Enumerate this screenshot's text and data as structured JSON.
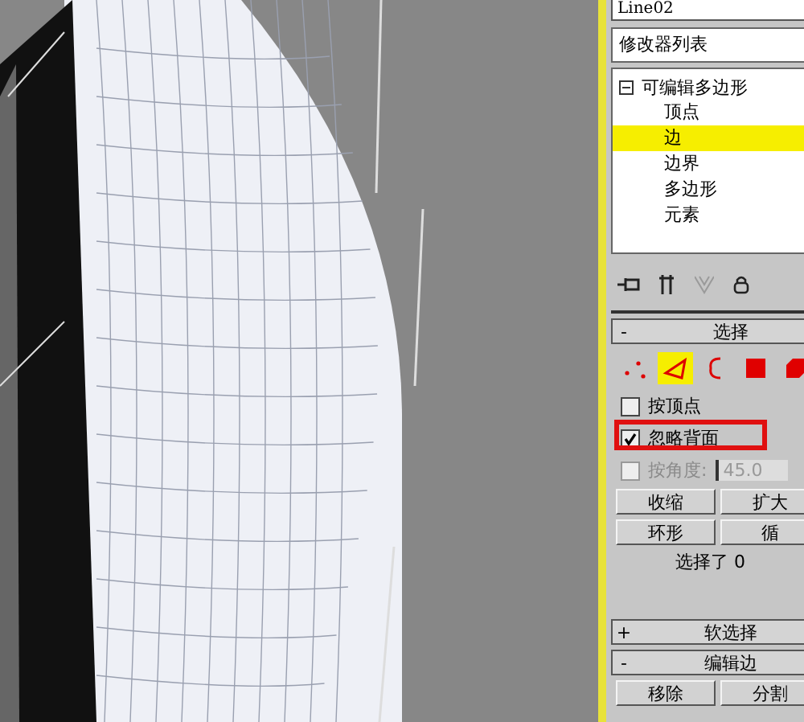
{
  "object_name": "Line02",
  "modifier_list": {
    "value": "修改器列表"
  },
  "stack": {
    "label": "可编辑多边形",
    "expanded": true,
    "children": [
      {
        "label": "顶点",
        "selected": false
      },
      {
        "label": "边",
        "selected": true
      },
      {
        "label": "边界",
        "selected": false
      },
      {
        "label": "多边形",
        "selected": false
      },
      {
        "label": "元素",
        "selected": false
      }
    ]
  },
  "selection": {
    "toggle": "-",
    "title": "选择",
    "levels": [
      {
        "kind": "vertex",
        "selected": false
      },
      {
        "kind": "edge",
        "selected": true
      },
      {
        "kind": "border",
        "selected": false
      },
      {
        "kind": "polygon",
        "selected": false
      },
      {
        "kind": "element",
        "selected": false
      }
    ],
    "options": [
      {
        "label": "按顶点",
        "checked": false,
        "disabled": false,
        "highlighted": false
      },
      {
        "label": "忽略背面",
        "checked": true,
        "disabled": false,
        "highlighted": true
      },
      {
        "label": "按角度:",
        "checked": false,
        "disabled": true,
        "highlighted": false,
        "value": "45.0"
      }
    ],
    "buttons": [
      "收缩",
      "扩大",
      "环形",
      "循"
    ],
    "status": "选择了 0"
  },
  "rollouts": [
    {
      "toggle": "+",
      "title": "软选择"
    },
    {
      "toggle": "-",
      "title": "编辑边"
    }
  ],
  "edit_edge_buttons": [
    "移除",
    "分割"
  ]
}
